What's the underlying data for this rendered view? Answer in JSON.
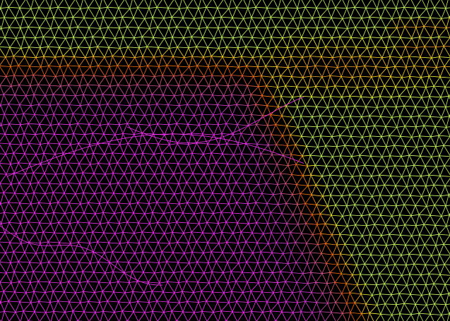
{
  "scene": {
    "type": "3d-wireframe-terrain-mesh",
    "background_color": "#000000",
    "colormap": [
      {
        "level": 0.0,
        "color": "#0a0a3a"
      },
      {
        "level": 0.12,
        "color": "#0018c8"
      },
      {
        "level": 0.25,
        "color": "#1a8cff"
      },
      {
        "level": 0.35,
        "color": "#19e6ff"
      },
      {
        "level": 0.48,
        "color": "#ffff33"
      },
      {
        "level": 0.6,
        "color": "#ffa020"
      },
      {
        "level": 0.7,
        "color": "#ff6a00"
      },
      {
        "level": 0.8,
        "color": "#d85a8a"
      },
      {
        "level": 0.9,
        "color": "#d63ad6"
      },
      {
        "level": 1.0,
        "color": "#ff33ff"
      }
    ]
  }
}
